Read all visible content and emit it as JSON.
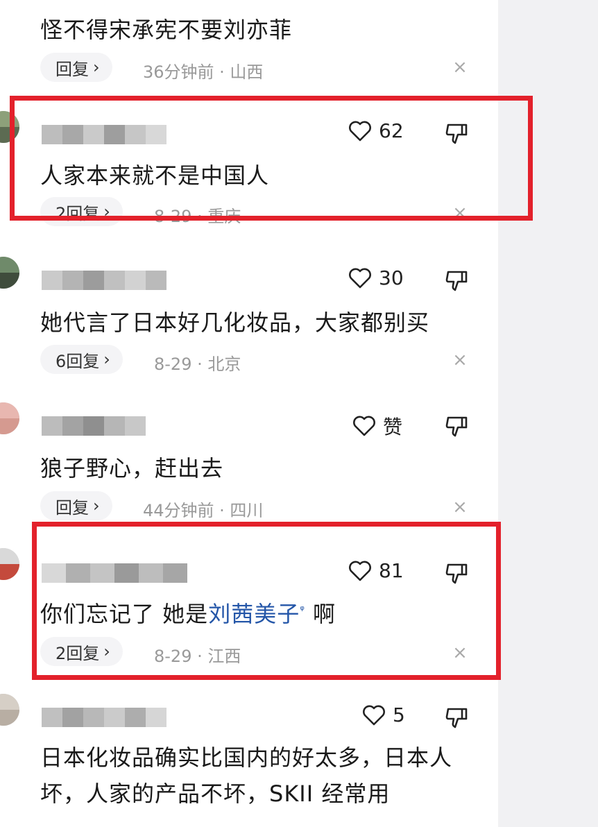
{
  "comments": [
    {
      "text": "怪不得宋承宪不要刘亦菲",
      "reply_label": "回复",
      "meta": "36分钟前 · 山西"
    },
    {
      "likes": "62",
      "text": "人家本来就不是中国人",
      "reply_label": "2回复",
      "meta": "8-29 · 重庆"
    },
    {
      "likes": "30",
      "text": "她代言了日本好几化妆品，大家都别买",
      "reply_label": "6回复",
      "meta": "8-29 · 北京"
    },
    {
      "likes": "赞",
      "text": "狼子野心，赶出去",
      "reply_label": "回复",
      "meta": "44分钟前 · 四川"
    },
    {
      "likes": "81",
      "text_before": "你们忘记了 她是",
      "text_link": "刘茜美子",
      "text_after": " 啊",
      "reply_label": "2回复",
      "meta": "8-29 · 江西"
    },
    {
      "likes": "5",
      "text": "日本化妆品确实比国内的好太多，日本人坏，人家的产品不坏，SKII 经常用"
    }
  ],
  "icons": {
    "chevron": "›",
    "close": "×",
    "search": "ᵠ"
  },
  "colors": {
    "highlight_box": "#e3212b",
    "link": "#2456a8"
  }
}
